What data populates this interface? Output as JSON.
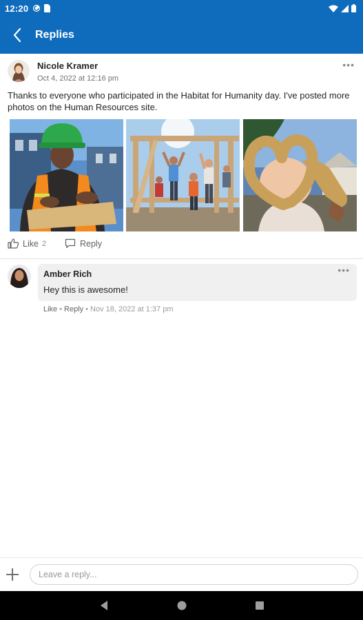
{
  "status_bar": {
    "time": "12:20"
  },
  "header": {
    "title": "Replies"
  },
  "post": {
    "author": "Nicole Kramer",
    "date": "Oct 4, 2022 at 12:16 pm",
    "body": "Thanks to everyone who participated in the Habitat for Humanity day. I've posted more photos on the Human Resources site.",
    "like_label": "Like",
    "like_count": "2",
    "reply_label": "Reply"
  },
  "reply": {
    "author": "Amber Rich",
    "text": "Hey this is awesome!",
    "like_label": "Like",
    "reply_label": "Reply",
    "timestamp": "Nov 18, 2022 at 1:37 pm"
  },
  "composer": {
    "placeholder": "Leave a reply..."
  },
  "icons": {
    "back": "back-arrow-icon",
    "more": "more-horizontal-icon",
    "like": "thumbs-up-icon",
    "reply": "comment-icon",
    "add": "plus-icon",
    "nav": [
      "back-triangle-icon",
      "home-circle-icon",
      "recents-square-icon"
    ]
  },
  "colors": {
    "brand": "#0f6cbd",
    "bubble": "#f0f0f0",
    "meta_text": "#707070"
  }
}
